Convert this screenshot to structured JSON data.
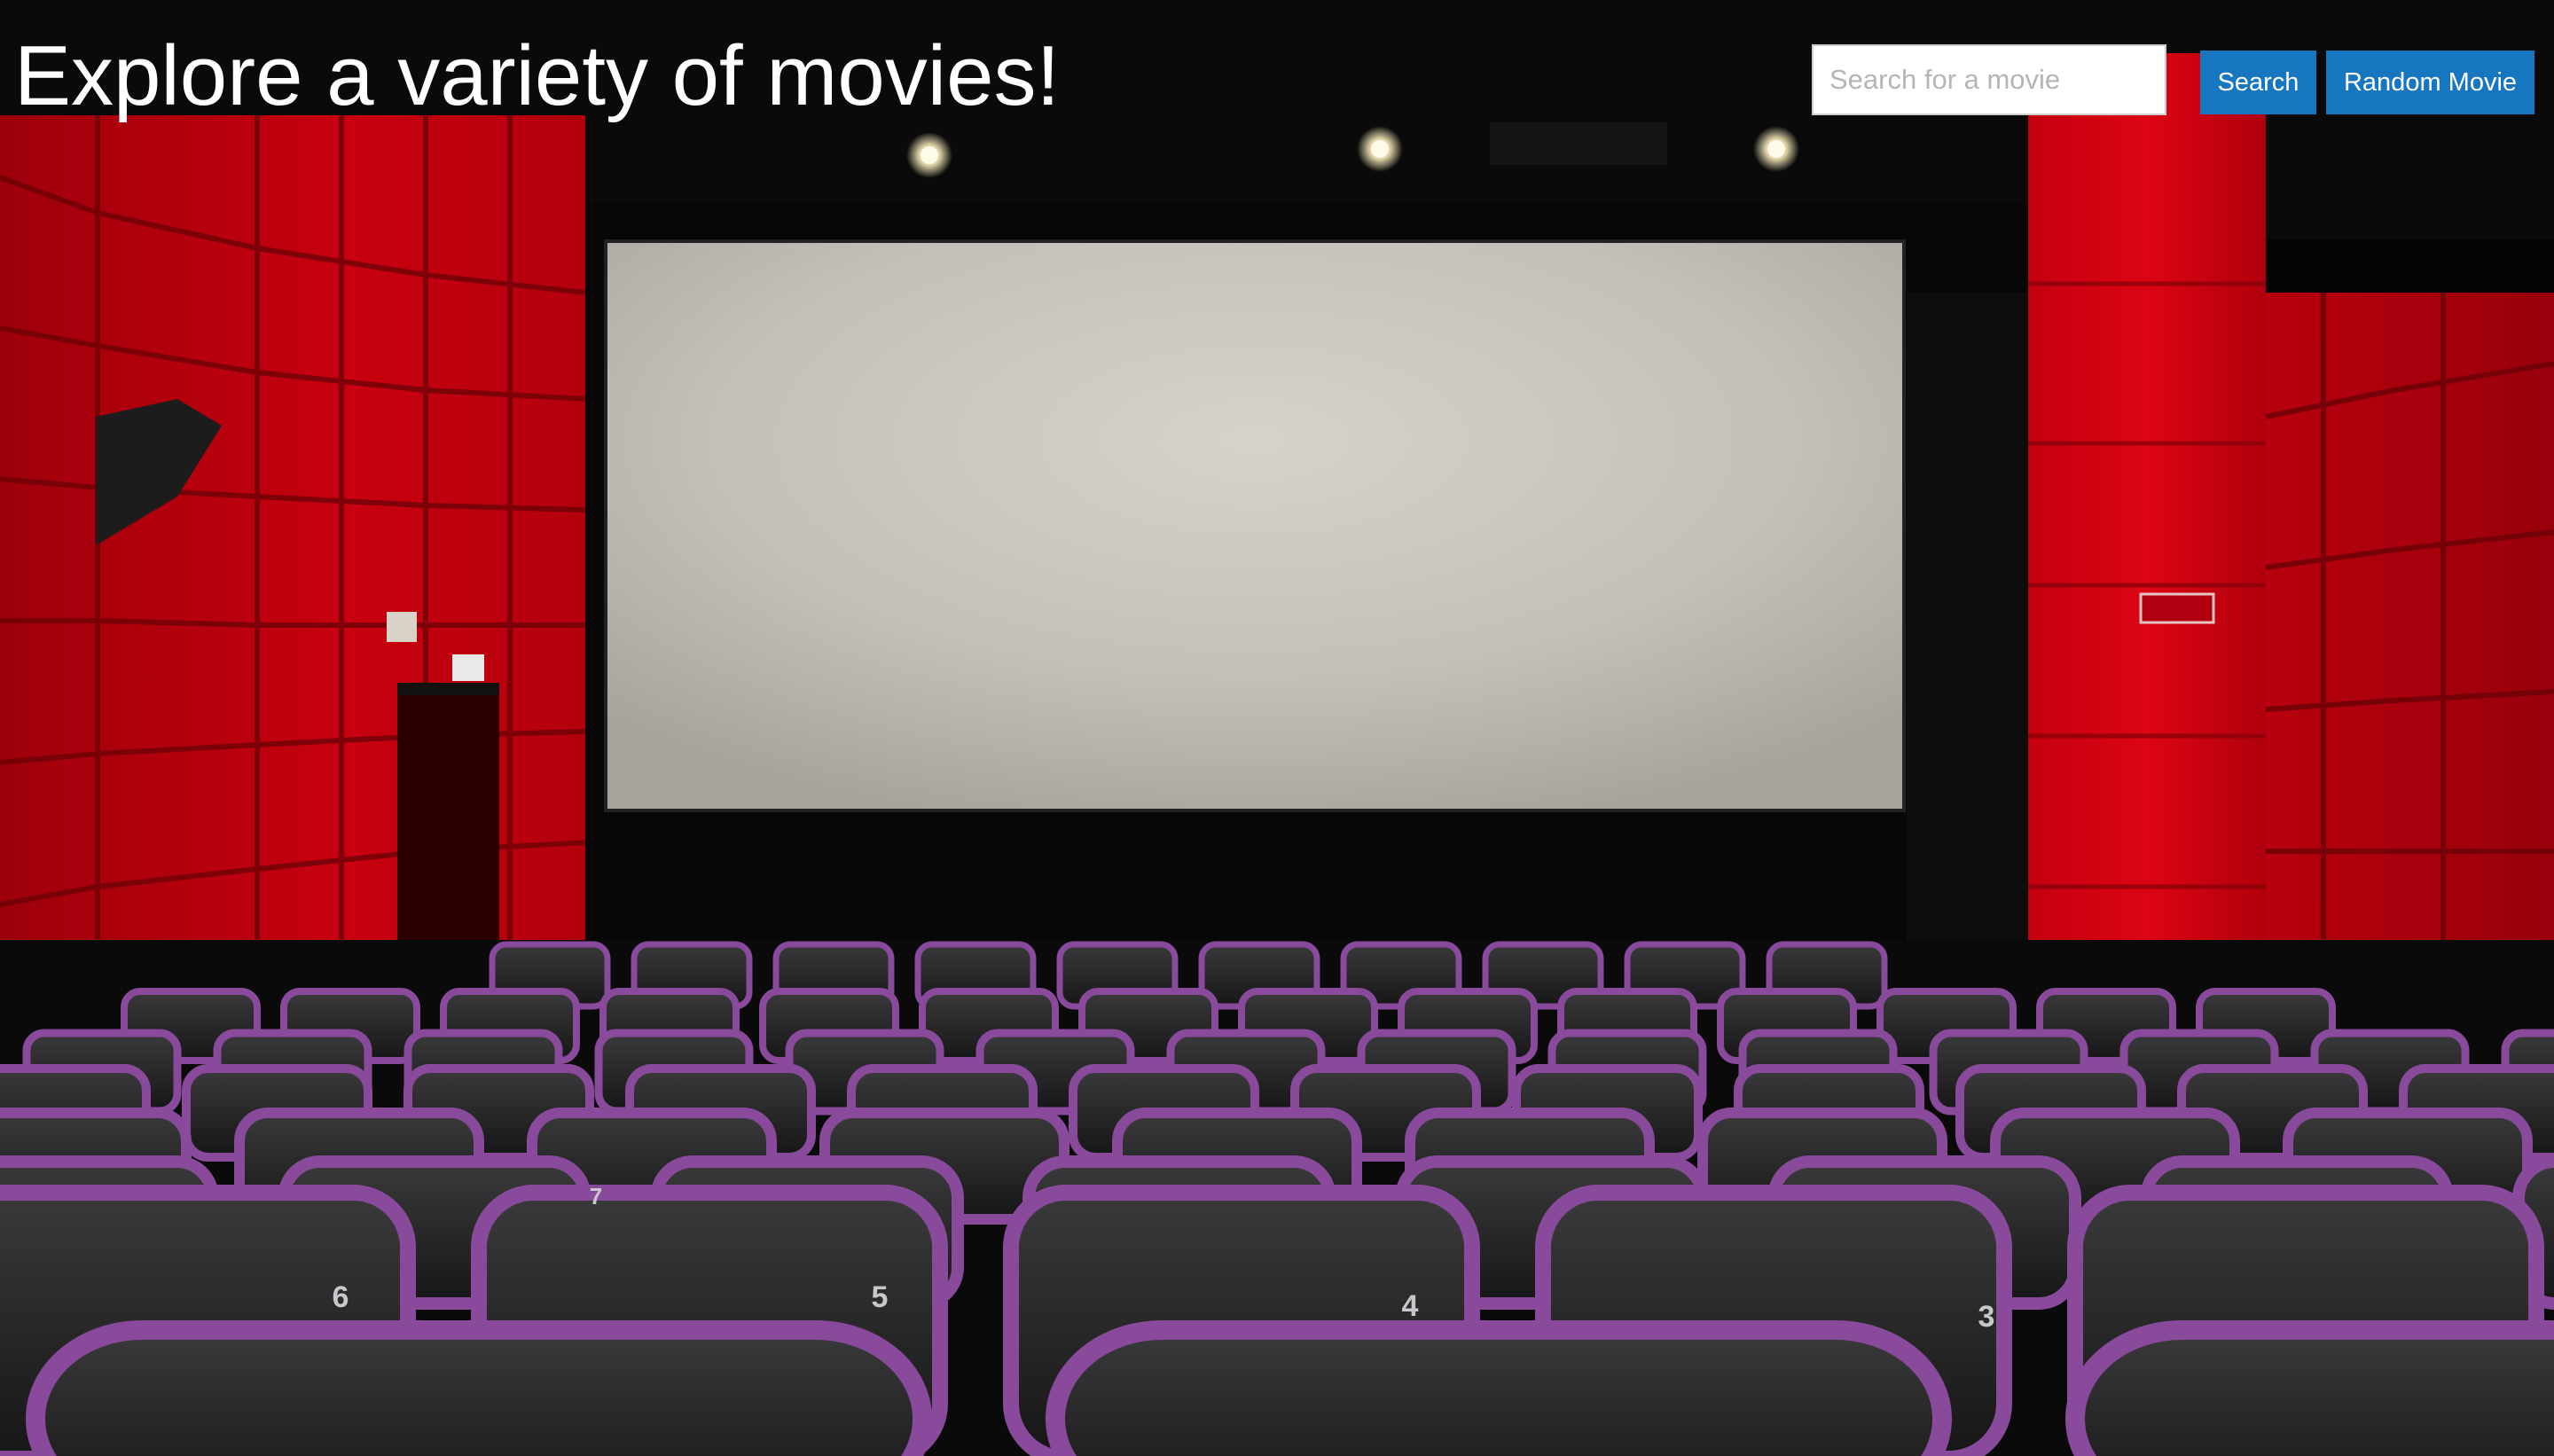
{
  "header": {
    "title": "Explore a variety of movies!"
  },
  "search": {
    "placeholder": "Search for a movie",
    "value": "",
    "button_label": "Search"
  },
  "random_button": {
    "label": "Random Movie"
  },
  "colors": {
    "button_bg": "#1676c0",
    "button_text": "#ffffff",
    "title_text": "#ffffff",
    "wall_red": "#c5000f",
    "seat_purple": "#8a4a9c",
    "screen": "#c9c5bf"
  },
  "background": {
    "seat_numbers": [
      "7",
      "6",
      "5",
      "4",
      "3"
    ]
  }
}
